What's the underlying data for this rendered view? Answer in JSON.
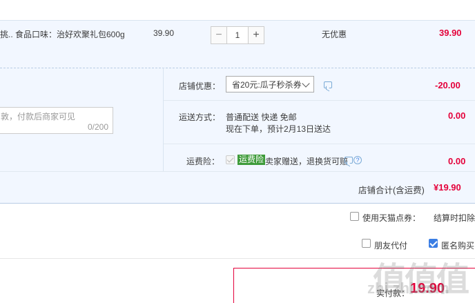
{
  "item": {
    "title_fragment": "挑..",
    "flavor": "食品口味：治好欢聚礼包600g",
    "unit_price": "39.90",
    "quantity": "1",
    "minus": "−",
    "plus": "+",
    "discount": "无优惠",
    "subtotal": "39.90"
  },
  "shop": {
    "coupon_label": "店铺优惠：",
    "coupon_selected": "省20元:瓜子秒杀券",
    "coupon_amount": "-20.00",
    "message_placeholder": "敦，付款后商家可见",
    "message_counter": "0/200",
    "shipping_label": "运送方式：",
    "shipping_method": "普通配送 快递 免邮",
    "shipping_eta": "现在下单，预计2月13日送达",
    "shipping_fee": "0.00",
    "insurance_label": "运费险：",
    "insurance_badge": "运费险",
    "insurance_text": "卖家赠送，退换货可赔",
    "insurance_fee": "0.00",
    "help_glyph": "?",
    "total_label": "店铺合计(含运费)",
    "total_value": "¥19.90"
  },
  "options": {
    "tmall_points_label": "使用天猫点券：",
    "tmall_points_note": "结算时扣除",
    "friend_pay_label": "朋友代付",
    "anonymous_label": "匿名购买"
  },
  "payment": {
    "label": "实付款：",
    "value": "19.90"
  },
  "watermark": {
    "logo": "值值值",
    "site": "zhi.zhi.com"
  },
  "colors": {
    "accent_red": "#e4003a",
    "panel_bg": "#f2f7ff",
    "checkbox_blue": "#3b7ee4",
    "badge_green": "#3e9b3a"
  },
  "icons": [
    "minus-icon",
    "plus-icon",
    "chevron-down-icon",
    "message-icon",
    "help-icon",
    "checkbox-icon"
  ]
}
